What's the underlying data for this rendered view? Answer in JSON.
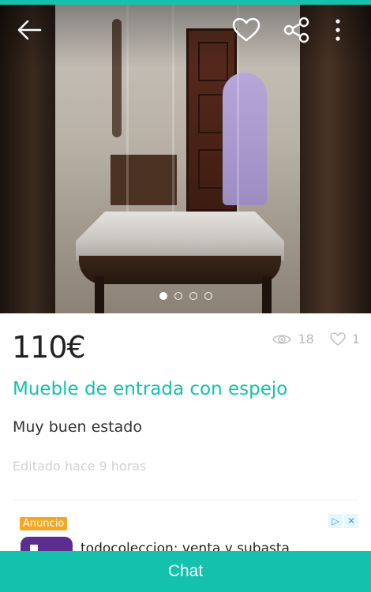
{
  "listing": {
    "price": "110€",
    "title": "Mueble de entrada con espejo",
    "description": "Muy buen estado",
    "edited": "Editado hace 9 horas",
    "views": "18",
    "likes": "1",
    "photo_count": 4,
    "active_photo": 1
  },
  "toolbar": {
    "back_icon": "arrow-left-icon",
    "favorite_icon": "heart-outline-icon",
    "share_icon": "share-icon",
    "more_icon": "more-vertical-icon"
  },
  "ad": {
    "badge": "Anuncio",
    "headline": "todocoleccion: venta y subasta",
    "adchoices_icon": "adchoices-icon",
    "close_icon": "close-icon"
  },
  "actions": {
    "chat_label": "Chat"
  },
  "colors": {
    "accent": "#13c1ac",
    "badge": "#f5a623"
  }
}
